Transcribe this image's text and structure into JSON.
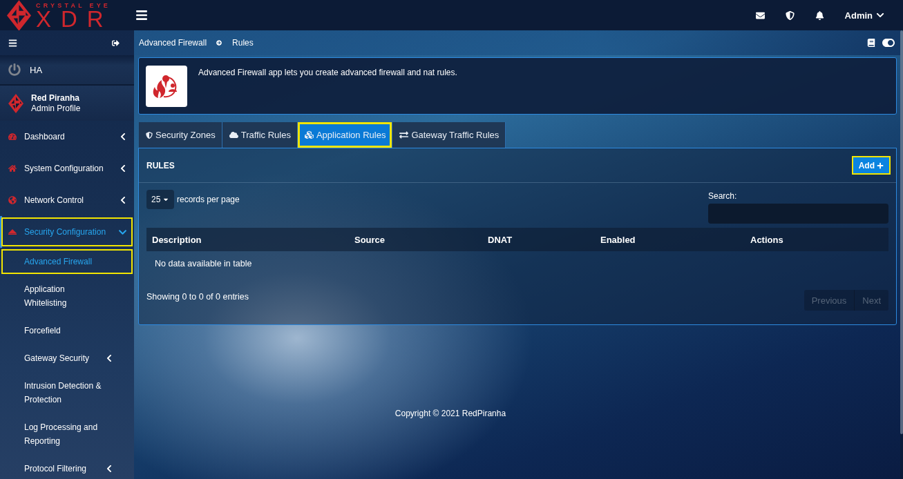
{
  "logo": {
    "tagline": "CRYSTAL EYE",
    "wordmark": "XDR"
  },
  "topbar": {
    "user": "Admin"
  },
  "sidebar": {
    "ha_label": "HA",
    "profile": {
      "name": "Red Piranha",
      "role": "Admin Profile"
    },
    "items": [
      {
        "label": "Dashboard",
        "kind": "group",
        "expanded": false,
        "selected": false,
        "highlighted": false
      },
      {
        "label": "System Configuration",
        "kind": "group",
        "expanded": false,
        "selected": false,
        "highlighted": false
      },
      {
        "label": "Network Control",
        "kind": "group",
        "expanded": false,
        "selected": false,
        "highlighted": false
      },
      {
        "label": "Security Configuration",
        "kind": "group",
        "expanded": true,
        "selected": true,
        "highlighted": true,
        "children": [
          {
            "label": "Advanced Firewall",
            "kind": "link",
            "selected": true,
            "highlighted": true
          },
          {
            "label": "Application Whitelisting",
            "kind": "link",
            "selected": false,
            "highlighted": false
          },
          {
            "label": "Forcefield",
            "kind": "link",
            "selected": false,
            "highlighted": false
          },
          {
            "label": "Gateway Security",
            "kind": "group",
            "expanded": false,
            "selected": false,
            "highlighted": false
          },
          {
            "label": "Intrusion Detection & Protection",
            "kind": "link",
            "selected": false,
            "highlighted": false
          },
          {
            "label": "Log Processing and Reporting",
            "kind": "link",
            "selected": false,
            "highlighted": false
          },
          {
            "label": "Protocol Filtering",
            "kind": "group",
            "expanded": false,
            "selected": false,
            "highlighted": false
          }
        ]
      }
    ]
  },
  "breadcrumb": [
    "Advanced Firewall",
    "Rules"
  ],
  "info": {
    "text": "Advanced Firewall app lets you create advanced firewall and nat rules."
  },
  "tabs": [
    {
      "label": "Security Zones",
      "selected": false,
      "highlighted": false
    },
    {
      "label": "Traffic Rules",
      "selected": false,
      "highlighted": false
    },
    {
      "label": "Application Rules",
      "selected": true,
      "highlighted": true
    },
    {
      "label": "Gateway Traffic Rules",
      "selected": false,
      "highlighted": false
    }
  ],
  "panel": {
    "title": "RULES",
    "add_button": {
      "label": "Add",
      "highlighted": true
    },
    "page_size": "25",
    "page_size_label": "records per page",
    "search_label": "Search:",
    "table": {
      "columns": [
        "Description",
        "Source",
        "DNAT",
        "Enabled",
        "Actions"
      ],
      "empty_text": "No data available in table"
    },
    "info": "Showing 0 to 0 of 0 entries",
    "pagination": [
      {
        "label": "Previous",
        "disabled": true
      },
      {
        "label": "Next",
        "disabled": true
      }
    ]
  },
  "footer": "Copyright © 2021 RedPiranha"
}
